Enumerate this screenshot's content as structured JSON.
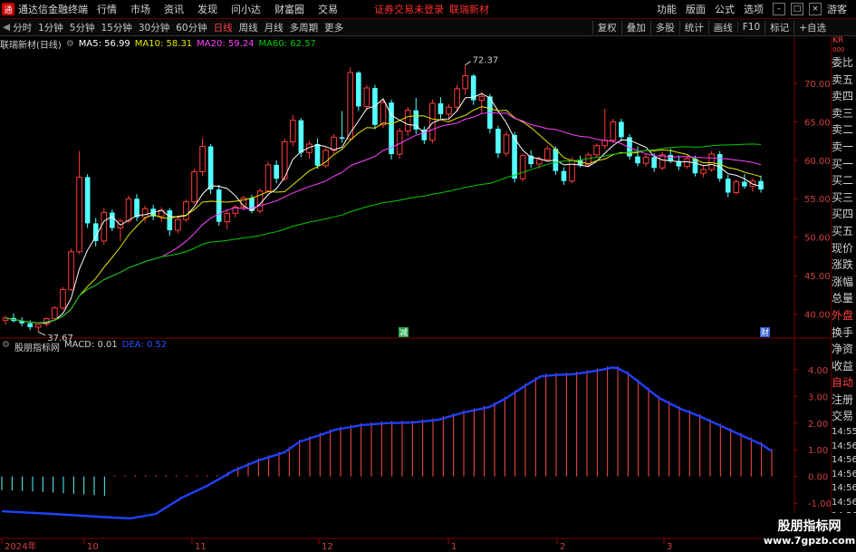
{
  "menubar": {
    "logo": "通",
    "app_name": "通达信金融终端",
    "items": [
      "行情",
      "市场",
      "资讯",
      "发现",
      "问小达",
      "财富圈",
      "交易"
    ],
    "notice": "证券交易未登录",
    "stock_name": "联瑞新材",
    "right_items": [
      "功能",
      "版面",
      "公式",
      "选项"
    ],
    "user": "游客"
  },
  "toolbar": {
    "timeframes": [
      "分时",
      "1分钟",
      "5分钟",
      "15分钟",
      "30分钟",
      "60分钟",
      "日线",
      "周线",
      "月线",
      "多周期",
      "更多"
    ],
    "active": "日线",
    "right_tools": [
      "复权",
      "叠加",
      "多股",
      "统计",
      "画线",
      "F10",
      "标记",
      "+自选"
    ],
    "back_btn": "◀"
  },
  "info": {
    "title": "联瑞新材(日线)",
    "ma5": "MA5: 56.99",
    "ma10": "MA10: 58.31",
    "ma20": "MA20: 59.24",
    "ma60": "MA60: 62.57",
    "colors": {
      "ma5": "#ffffff",
      "ma10": "#e6e600",
      "ma20": "#ff40ff",
      "ma60": "#00cc00"
    }
  },
  "price_axis": [
    "70.00",
    "65.00",
    "60.00",
    "55.00",
    "50.00",
    "45.00",
    "40.00"
  ],
  "annotations": {
    "high": "72.37",
    "low": "37.67",
    "event1": "减",
    "event2": "财"
  },
  "macd": {
    "title": "股朋指标网",
    "macd_label": "MACD: 0.01",
    "dea_label": "DEA: 0.52",
    "axis": [
      "4.00",
      "3.00",
      "2.00",
      "1.00",
      "0.00",
      "-1.00"
    ]
  },
  "x_axis": [
    "2024年",
    "10",
    "11",
    "12",
    "1",
    "2",
    "3"
  ],
  "side_panel": {
    "kr": "KR",
    "kr2": "000",
    "items": [
      "委比",
      "卖五",
      "卖四",
      "卖三",
      "卖二",
      "卖一",
      "买一",
      "买二",
      "买三",
      "买四",
      "买五",
      "现价",
      "涨跌",
      "涨幅",
      "总量",
      "外盘",
      "换手",
      "净资",
      "收益"
    ],
    "red_items": [
      "外盘"
    ],
    "times": [
      "14:55",
      "14:56",
      "14:56",
      "14:56",
      "14:56",
      "14:56",
      "14:56",
      "14:56"
    ],
    "auto": "自动",
    "register": "注册",
    "trade": "交易"
  },
  "chart_data": {
    "type": "candlestick",
    "price_range": [
      37,
      74
    ],
    "candles": [
      [
        39.2,
        39.8,
        38.6,
        39.5
      ],
      [
        39.5,
        40.1,
        38.9,
        39.1
      ],
      [
        39.1,
        39.6,
        38.4,
        38.8
      ],
      [
        38.8,
        39.2,
        37.9,
        38.3
      ],
      [
        38.3,
        38.9,
        37.7,
        38.7
      ],
      [
        38.7,
        39.6,
        38.4,
        39.4
      ],
      [
        39.4,
        41.0,
        39.2,
        40.8
      ],
      [
        40.8,
        43.5,
        40.5,
        43.2
      ],
      [
        43.2,
        48.5,
        43.0,
        48.1
      ],
      [
        48.1,
        61.2,
        47.8,
        57.8
      ],
      [
        57.8,
        58.2,
        51.2,
        51.8
      ],
      [
        51.8,
        52.5,
        48.8,
        49.5
      ],
      [
        49.5,
        53.8,
        49.0,
        53.2
      ],
      [
        53.2,
        53.6,
        50.8,
        51.2
      ],
      [
        51.2,
        52.4,
        49.5,
        52.1
      ],
      [
        52.1,
        55.4,
        51.8,
        55.0
      ],
      [
        55.0,
        55.6,
        52.1,
        52.6
      ],
      [
        52.6,
        54.1,
        51.9,
        53.7
      ],
      [
        53.7,
        54.2,
        52.2,
        52.7
      ],
      [
        52.7,
        53.9,
        52.0,
        53.5
      ],
      [
        53.5,
        53.8,
        50.2,
        50.9
      ],
      [
        50.9,
        52.6,
        50.5,
        52.3
      ],
      [
        52.3,
        54.9,
        52.0,
        54.6
      ],
      [
        54.6,
        58.9,
        54.3,
        58.5
      ],
      [
        58.5,
        62.9,
        58.0,
        61.8
      ],
      [
        61.8,
        62.1,
        55.6,
        56.2
      ],
      [
        56.2,
        56.8,
        51.5,
        52.0
      ],
      [
        52.0,
        53.6,
        51.0,
        53.1
      ],
      [
        53.1,
        54.2,
        52.6,
        53.9
      ],
      [
        53.9,
        55.4,
        53.5,
        55.1
      ],
      [
        55.1,
        55.5,
        53.1,
        53.4
      ],
      [
        53.4,
        56.3,
        53.1,
        56.0
      ],
      [
        56.0,
        59.8,
        55.8,
        59.4
      ],
      [
        59.4,
        60.0,
        57.0,
        57.6
      ],
      [
        57.6,
        62.8,
        57.3,
        62.4
      ],
      [
        62.4,
        65.9,
        61.8,
        65.2
      ],
      [
        65.2,
        65.5,
        60.4,
        61.0
      ],
      [
        61.0,
        62.5,
        60.2,
        62.1
      ],
      [
        62.1,
        62.8,
        58.9,
        59.3
      ],
      [
        59.3,
        61.6,
        59.0,
        61.3
      ],
      [
        61.3,
        63.4,
        60.8,
        63.0
      ],
      [
        63.0,
        66.4,
        62.3,
        62.8
      ],
      [
        62.8,
        72.1,
        62.5,
        71.4
      ],
      [
        71.4,
        71.6,
        66.4,
        67.0
      ],
      [
        67.0,
        69.8,
        66.5,
        69.4
      ],
      [
        69.4,
        69.8,
        64.0,
        64.6
      ],
      [
        64.6,
        67.8,
        64.2,
        67.5
      ],
      [
        67.5,
        67.9,
        60.1,
        60.8
      ],
      [
        60.8,
        64.2,
        60.2,
        63.8
      ],
      [
        63.8,
        66.9,
        63.2,
        66.5
      ],
      [
        66.5,
        68.1,
        63.4,
        64.0
      ],
      [
        64.0,
        64.4,
        62.1,
        62.6
      ],
      [
        62.6,
        67.9,
        62.2,
        67.4
      ],
      [
        67.4,
        68.2,
        65.4,
        66.0
      ],
      [
        66.0,
        67.3,
        65.2,
        66.9
      ],
      [
        66.9,
        69.8,
        66.3,
        69.3
      ],
      [
        69.3,
        72.4,
        68.5,
        71.0
      ],
      [
        71.0,
        71.2,
        67.2,
        67.8
      ],
      [
        67.8,
        68.9,
        66.0,
        68.3
      ],
      [
        68.3,
        68.6,
        63.5,
        64.1
      ],
      [
        64.1,
        64.5,
        60.3,
        60.9
      ],
      [
        60.9,
        63.8,
        60.5,
        63.3
      ],
      [
        63.3,
        63.7,
        57.1,
        57.6
      ],
      [
        57.6,
        60.9,
        57.2,
        60.6
      ],
      [
        60.6,
        61.3,
        59.0,
        59.5
      ],
      [
        59.5,
        60.5,
        58.9,
        60.1
      ],
      [
        60.1,
        61.9,
        59.8,
        61.5
      ],
      [
        61.5,
        61.8,
        58.1,
        58.6
      ],
      [
        58.6,
        59.1,
        56.8,
        57.3
      ],
      [
        57.3,
        60.4,
        57.0,
        60.0
      ],
      [
        60.0,
        60.6,
        59.1,
        59.4
      ],
      [
        59.4,
        61.0,
        59.1,
        60.7
      ],
      [
        60.7,
        62.2,
        60.3,
        61.9
      ],
      [
        61.9,
        66.7,
        61.5,
        62.6
      ],
      [
        62.6,
        65.4,
        62.2,
        65.0
      ],
      [
        65.0,
        65.4,
        62.5,
        63.0
      ],
      [
        63.0,
        63.4,
        60.1,
        60.5
      ],
      [
        60.5,
        61.8,
        59.2,
        59.6
      ],
      [
        59.6,
        60.8,
        59.2,
        60.4
      ],
      [
        60.4,
        60.9,
        58.5,
        59.0
      ],
      [
        59.0,
        61.1,
        58.7,
        60.7
      ],
      [
        60.7,
        61.5,
        59.6,
        59.9
      ],
      [
        59.9,
        60.6,
        58.7,
        59.2
      ],
      [
        59.2,
        60.6,
        58.9,
        60.2
      ],
      [
        60.2,
        60.6,
        57.9,
        58.3
      ],
      [
        58.3,
        59.2,
        57.8,
        58.8
      ],
      [
        58.8,
        61.2,
        58.5,
        60.8
      ],
      [
        60.8,
        61.2,
        57.2,
        57.6
      ],
      [
        57.6,
        58.1,
        55.2,
        55.8
      ],
      [
        55.8,
        57.5,
        55.5,
        57.2
      ],
      [
        57.2,
        58.2,
        56.3,
        56.6
      ],
      [
        56.6,
        57.7,
        55.9,
        57.3
      ],
      [
        57.3,
        58.0,
        55.8,
        56.2
      ]
    ],
    "macd_range": [
      -1.4,
      4.4
    ],
    "dif_points": [
      [
        0,
        -1.3
      ],
      [
        10,
        -1.4
      ],
      [
        20,
        -1.52
      ],
      [
        25,
        -1.57
      ],
      [
        30,
        -1.4
      ],
      [
        35,
        -0.8
      ],
      [
        40,
        -0.35
      ],
      [
        45,
        0.2
      ],
      [
        50,
        0.6
      ],
      [
        55,
        0.9
      ],
      [
        58,
        1.3
      ],
      [
        62,
        1.55
      ],
      [
        65,
        1.75
      ],
      [
        70,
        1.92
      ],
      [
        75,
        2.0
      ],
      [
        80,
        2.02
      ],
      [
        85,
        2.12
      ],
      [
        90,
        2.4
      ],
      [
        95,
        2.6
      ],
      [
        98,
        2.9
      ],
      [
        102,
        3.4
      ],
      [
        105,
        3.75
      ],
      [
        108,
        3.8
      ],
      [
        111,
        3.82
      ],
      [
        114,
        3.9
      ],
      [
        117,
        4.0
      ],
      [
        119,
        4.08
      ],
      [
        120,
        4.05
      ],
      [
        122,
        3.85
      ],
      [
        125,
        3.4
      ],
      [
        128,
        2.95
      ],
      [
        132,
        2.55
      ],
      [
        136,
        2.25
      ],
      [
        140,
        1.9
      ],
      [
        144,
        1.55
      ],
      [
        148,
        1.2
      ],
      [
        150,
        0.95
      ]
    ]
  }
}
